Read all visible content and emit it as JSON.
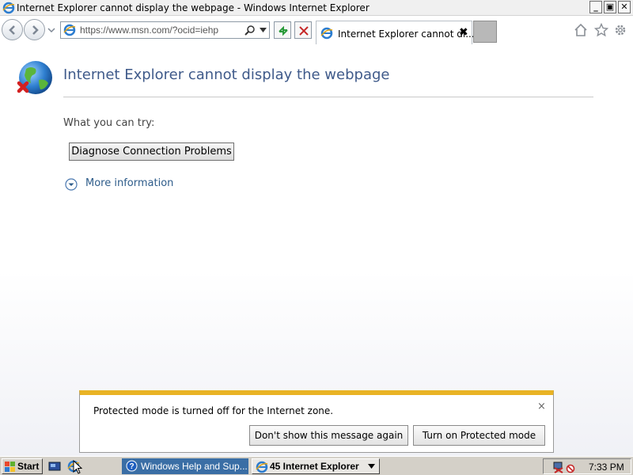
{
  "window": {
    "title": "Internet Explorer cannot display the webpage - Windows Internet Explorer",
    "minimize_label": "_",
    "maximize_label": "▣",
    "close_label": "✕"
  },
  "navbar": {
    "url": "https://www.msn.com/?ocid=iehp",
    "tab_title": "Internet Explorer cannot di...",
    "tab_close": "✖"
  },
  "content": {
    "title": "Internet Explorer cannot display the webpage",
    "try_label": "What you can try:",
    "diagnose_button": "Diagnose Connection Problems",
    "more_info": "More information"
  },
  "notification": {
    "message": "Protected mode is turned off for the Internet zone.",
    "close": "×",
    "dont_show_button": "Don't show this message again",
    "turn_on_button": "Turn on Protected mode"
  },
  "taskbar": {
    "start_label": "Start",
    "tasks": [
      {
        "label": "Windows Help and Sup..."
      },
      {
        "label": "45 Internet Explorer"
      }
    ],
    "clock": "7:33 PM"
  },
  "icons": {
    "app": "ie-icon",
    "globe": "globe-error-icon",
    "home": "home-icon",
    "favorites": "star-icon",
    "tools": "gear-icon"
  },
  "colors": {
    "title_text": "#3f5a8a",
    "link_text": "#2e5c8a",
    "notification_accent": "#e9b325",
    "taskbar_active": "#3a6ea5"
  }
}
